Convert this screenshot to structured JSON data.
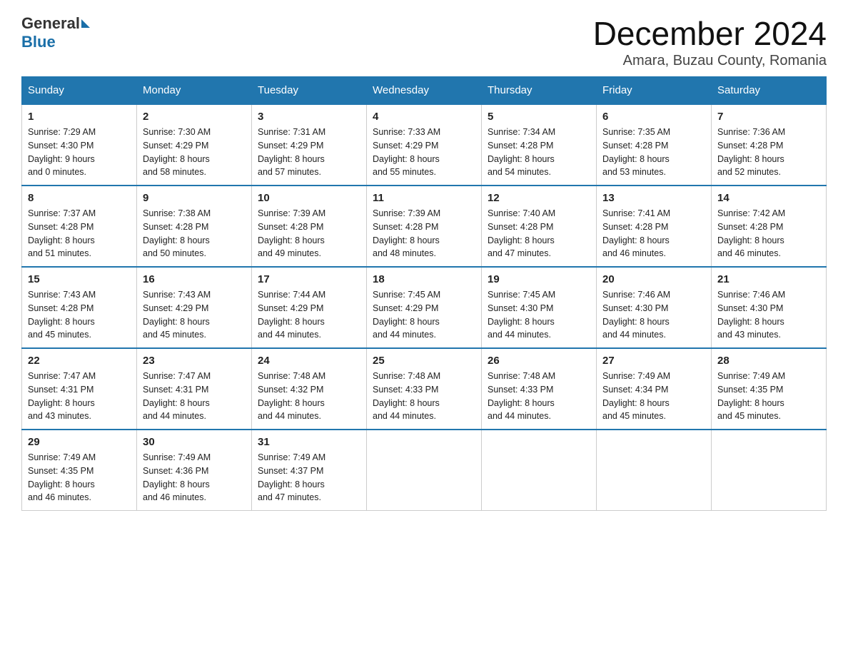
{
  "header": {
    "logo_general": "General",
    "logo_blue": "Blue",
    "title": "December 2024",
    "subtitle": "Amara, Buzau County, Romania"
  },
  "days_of_week": [
    "Sunday",
    "Monday",
    "Tuesday",
    "Wednesday",
    "Thursday",
    "Friday",
    "Saturday"
  ],
  "weeks": [
    [
      {
        "num": "1",
        "sunrise": "7:29 AM",
        "sunset": "4:30 PM",
        "daylight": "9 hours and 0 minutes."
      },
      {
        "num": "2",
        "sunrise": "7:30 AM",
        "sunset": "4:29 PM",
        "daylight": "8 hours and 58 minutes."
      },
      {
        "num": "3",
        "sunrise": "7:31 AM",
        "sunset": "4:29 PM",
        "daylight": "8 hours and 57 minutes."
      },
      {
        "num": "4",
        "sunrise": "7:33 AM",
        "sunset": "4:29 PM",
        "daylight": "8 hours and 55 minutes."
      },
      {
        "num": "5",
        "sunrise": "7:34 AM",
        "sunset": "4:28 PM",
        "daylight": "8 hours and 54 minutes."
      },
      {
        "num": "6",
        "sunrise": "7:35 AM",
        "sunset": "4:28 PM",
        "daylight": "8 hours and 53 minutes."
      },
      {
        "num": "7",
        "sunrise": "7:36 AM",
        "sunset": "4:28 PM",
        "daylight": "8 hours and 52 minutes."
      }
    ],
    [
      {
        "num": "8",
        "sunrise": "7:37 AM",
        "sunset": "4:28 PM",
        "daylight": "8 hours and 51 minutes."
      },
      {
        "num": "9",
        "sunrise": "7:38 AM",
        "sunset": "4:28 PM",
        "daylight": "8 hours and 50 minutes."
      },
      {
        "num": "10",
        "sunrise": "7:39 AM",
        "sunset": "4:28 PM",
        "daylight": "8 hours and 49 minutes."
      },
      {
        "num": "11",
        "sunrise": "7:39 AM",
        "sunset": "4:28 PM",
        "daylight": "8 hours and 48 minutes."
      },
      {
        "num": "12",
        "sunrise": "7:40 AM",
        "sunset": "4:28 PM",
        "daylight": "8 hours and 47 minutes."
      },
      {
        "num": "13",
        "sunrise": "7:41 AM",
        "sunset": "4:28 PM",
        "daylight": "8 hours and 46 minutes."
      },
      {
        "num": "14",
        "sunrise": "7:42 AM",
        "sunset": "4:28 PM",
        "daylight": "8 hours and 46 minutes."
      }
    ],
    [
      {
        "num": "15",
        "sunrise": "7:43 AM",
        "sunset": "4:28 PM",
        "daylight": "8 hours and 45 minutes."
      },
      {
        "num": "16",
        "sunrise": "7:43 AM",
        "sunset": "4:29 PM",
        "daylight": "8 hours and 45 minutes."
      },
      {
        "num": "17",
        "sunrise": "7:44 AM",
        "sunset": "4:29 PM",
        "daylight": "8 hours and 44 minutes."
      },
      {
        "num": "18",
        "sunrise": "7:45 AM",
        "sunset": "4:29 PM",
        "daylight": "8 hours and 44 minutes."
      },
      {
        "num": "19",
        "sunrise": "7:45 AM",
        "sunset": "4:30 PM",
        "daylight": "8 hours and 44 minutes."
      },
      {
        "num": "20",
        "sunrise": "7:46 AM",
        "sunset": "4:30 PM",
        "daylight": "8 hours and 44 minutes."
      },
      {
        "num": "21",
        "sunrise": "7:46 AM",
        "sunset": "4:30 PM",
        "daylight": "8 hours and 43 minutes."
      }
    ],
    [
      {
        "num": "22",
        "sunrise": "7:47 AM",
        "sunset": "4:31 PM",
        "daylight": "8 hours and 43 minutes."
      },
      {
        "num": "23",
        "sunrise": "7:47 AM",
        "sunset": "4:31 PM",
        "daylight": "8 hours and 44 minutes."
      },
      {
        "num": "24",
        "sunrise": "7:48 AM",
        "sunset": "4:32 PM",
        "daylight": "8 hours and 44 minutes."
      },
      {
        "num": "25",
        "sunrise": "7:48 AM",
        "sunset": "4:33 PM",
        "daylight": "8 hours and 44 minutes."
      },
      {
        "num": "26",
        "sunrise": "7:48 AM",
        "sunset": "4:33 PM",
        "daylight": "8 hours and 44 minutes."
      },
      {
        "num": "27",
        "sunrise": "7:49 AM",
        "sunset": "4:34 PM",
        "daylight": "8 hours and 45 minutes."
      },
      {
        "num": "28",
        "sunrise": "7:49 AM",
        "sunset": "4:35 PM",
        "daylight": "8 hours and 45 minutes."
      }
    ],
    [
      {
        "num": "29",
        "sunrise": "7:49 AM",
        "sunset": "4:35 PM",
        "daylight": "8 hours and 46 minutes."
      },
      {
        "num": "30",
        "sunrise": "7:49 AM",
        "sunset": "4:36 PM",
        "daylight": "8 hours and 46 minutes."
      },
      {
        "num": "31",
        "sunrise": "7:49 AM",
        "sunset": "4:37 PM",
        "daylight": "8 hours and 47 minutes."
      },
      null,
      null,
      null,
      null
    ]
  ],
  "labels": {
    "sunrise": "Sunrise:",
    "sunset": "Sunset:",
    "daylight": "Daylight:"
  }
}
